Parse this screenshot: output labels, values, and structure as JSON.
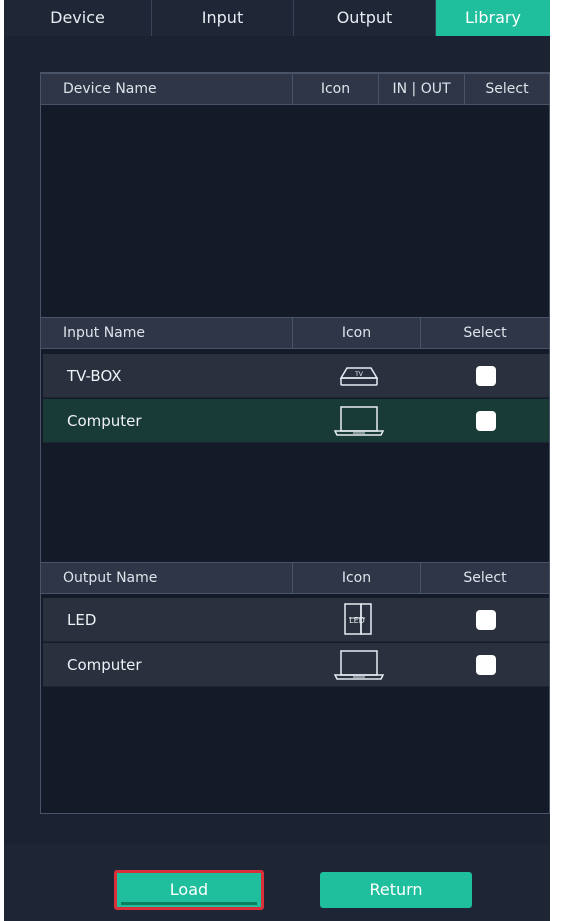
{
  "tabs": [
    {
      "label": "Device",
      "active": false
    },
    {
      "label": "Input",
      "active": false
    },
    {
      "label": "Output",
      "active": false
    },
    {
      "label": "Library",
      "active": true
    }
  ],
  "device_table": {
    "headers": [
      "Device Name",
      "Icon",
      "IN | OUT",
      "Select"
    ],
    "rows": []
  },
  "input_table": {
    "headers": [
      "Input Name",
      "Icon",
      "Select"
    ],
    "rows": [
      {
        "name": "TV-BOX",
        "icon": "tv-box-icon",
        "checked": false,
        "highlighted": false
      },
      {
        "name": "Computer",
        "icon": "laptop-icon",
        "checked": false,
        "highlighted": true
      }
    ]
  },
  "output_table": {
    "headers": [
      "Output Name",
      "Icon",
      "Select"
    ],
    "rows": [
      {
        "name": "LED",
        "icon": "led-screen-icon",
        "checked": false,
        "highlighted": false
      },
      {
        "name": "Computer",
        "icon": "laptop-icon",
        "checked": false,
        "highlighted": false
      }
    ]
  },
  "buttons": {
    "load": "Load",
    "return": "Return"
  },
  "colors": {
    "accent": "#1fbf9e",
    "background": "#1b2231",
    "panel": "#141a27",
    "header": "#2e3647",
    "highlight_row": "#183b38",
    "focus_border": "#d9303a"
  }
}
